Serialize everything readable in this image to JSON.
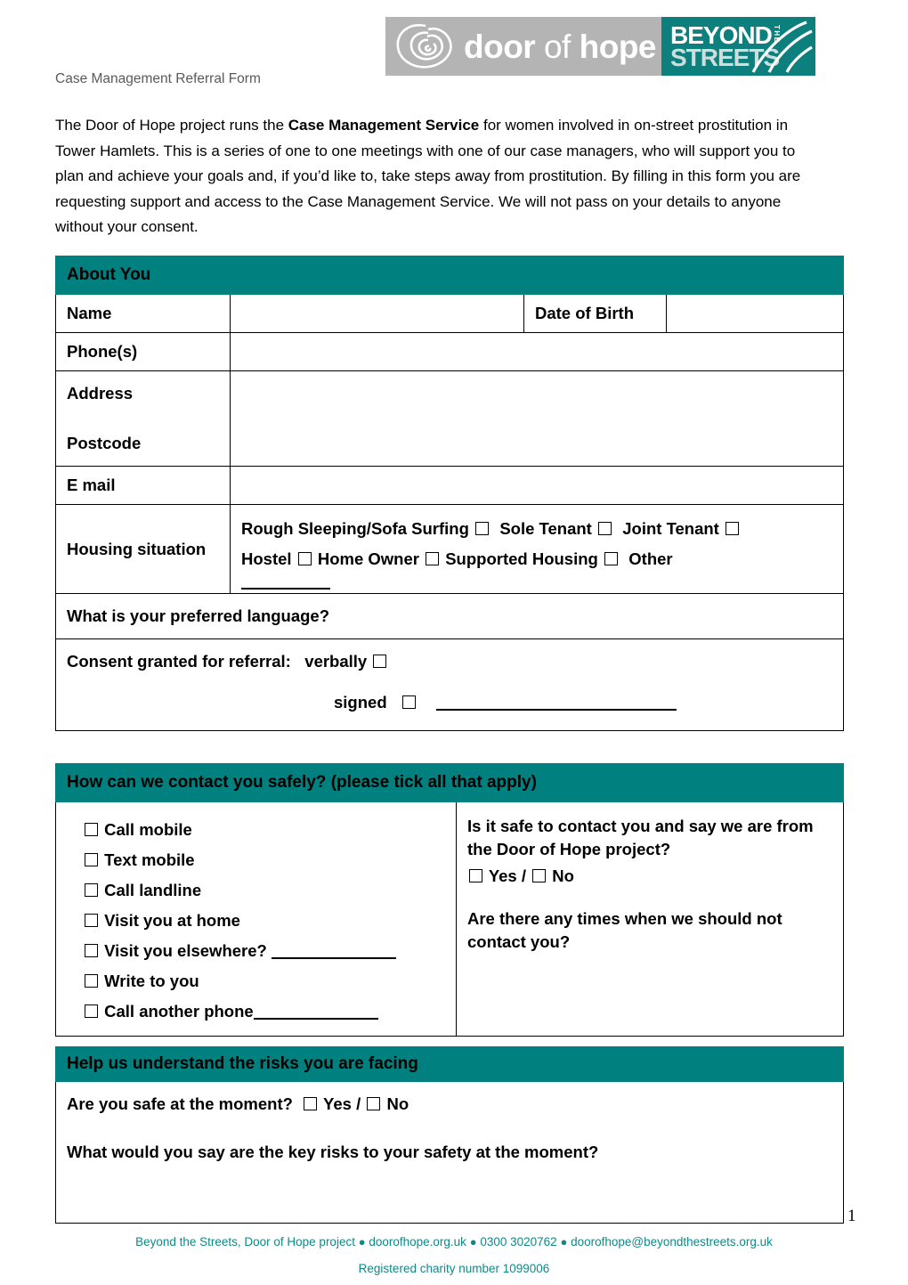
{
  "document": {
    "header_label": "Case Management Referral Form",
    "page_number": "1",
    "intro": {
      "part1": "The Door of Hope project runs the ",
      "bold": "Case Management Service",
      "part2": " for women involved in on-street prostitution in Tower Hamlets. This is a series of one to one meetings with one of our case managers, who will support you to plan and achieve your goals and, if you’d like to, take steps away from prostitution. By filling in this form you are requesting support and access to the Case Management Service. We will not pass on your details to anyone without your consent."
    }
  },
  "logo": {
    "word_door": "door",
    "word_of": " of ",
    "word_hope": "hope",
    "beyond": "BEYOND",
    "the": "THE",
    "streets": "STREETS",
    "rose_icon": "rose-spiral-icon",
    "swoosh_icon": "swoosh-lines-icon",
    "gray_hex": "#b4b4b4",
    "teal_hex": "#0d7f7d"
  },
  "colors": {
    "section_header_teal": "#00807e",
    "footer_teal": "#0e8a88",
    "border_black": "#000000"
  },
  "about_you": {
    "title": "About You",
    "name_label": "Name",
    "name_value": "",
    "dob_label": "Date of Birth",
    "dob_value": "",
    "phones_label": "Phone(s)",
    "phones_value": "",
    "address_label": "Address",
    "postcode_label": "Postcode",
    "address_value": "",
    "email_label": "E mail",
    "email_value": "",
    "housing_label": "Housing situation",
    "housing_options_row1": [
      "Rough Sleeping/Sofa Surfing",
      "Sole Tenant",
      "Joint Tenant"
    ],
    "housing_options_row2": [
      "Hostel",
      "Home Owner",
      "Supported Housing"
    ],
    "housing_other_label": "Other",
    "language_question": "What is your preferred language?",
    "language_value": "",
    "consent_label": "Consent granted for referral:",
    "consent_verbally": "verbally",
    "consent_signed": "signed"
  },
  "contact_safely": {
    "title": "How can we contact you safely? (please tick all that apply)",
    "options": [
      {
        "label": "Call mobile",
        "has_line": false
      },
      {
        "label": "Text mobile",
        "has_line": false
      },
      {
        "label": "Call landline",
        "has_line": false
      },
      {
        "label": "Visit you at home",
        "has_line": false
      },
      {
        "label": "Visit you elsewhere?",
        "has_line": true
      },
      {
        "label": "Write to you",
        "has_line": false
      },
      {
        "label": "Call another phone",
        "has_line": true
      }
    ],
    "safe_question": "Is it safe to contact you and say we are from the Door of Hope project?",
    "yes_label": "Yes",
    "slash": "/",
    "no_label": "No",
    "times_question": "Are there any times when we should not contact you?",
    "times_answer": ""
  },
  "risks": {
    "title": "Help us understand the risks you are facing",
    "safe_now_question": "Are you safe at the moment?",
    "yes_label": "Yes",
    "slash": "/",
    "no_label": "No",
    "key_risks_question": "What would you say are the key risks to your safety at the moment?",
    "key_risks_answer": ""
  },
  "footer": {
    "org": "Beyond the Streets, Door of Hope project",
    "website": "doorofhope.org.uk",
    "phone": "0300 3020762",
    "email": "doorofhope@beyondthestreets.org.uk",
    "separator": "●",
    "charity": "Registered charity number 1099006"
  }
}
